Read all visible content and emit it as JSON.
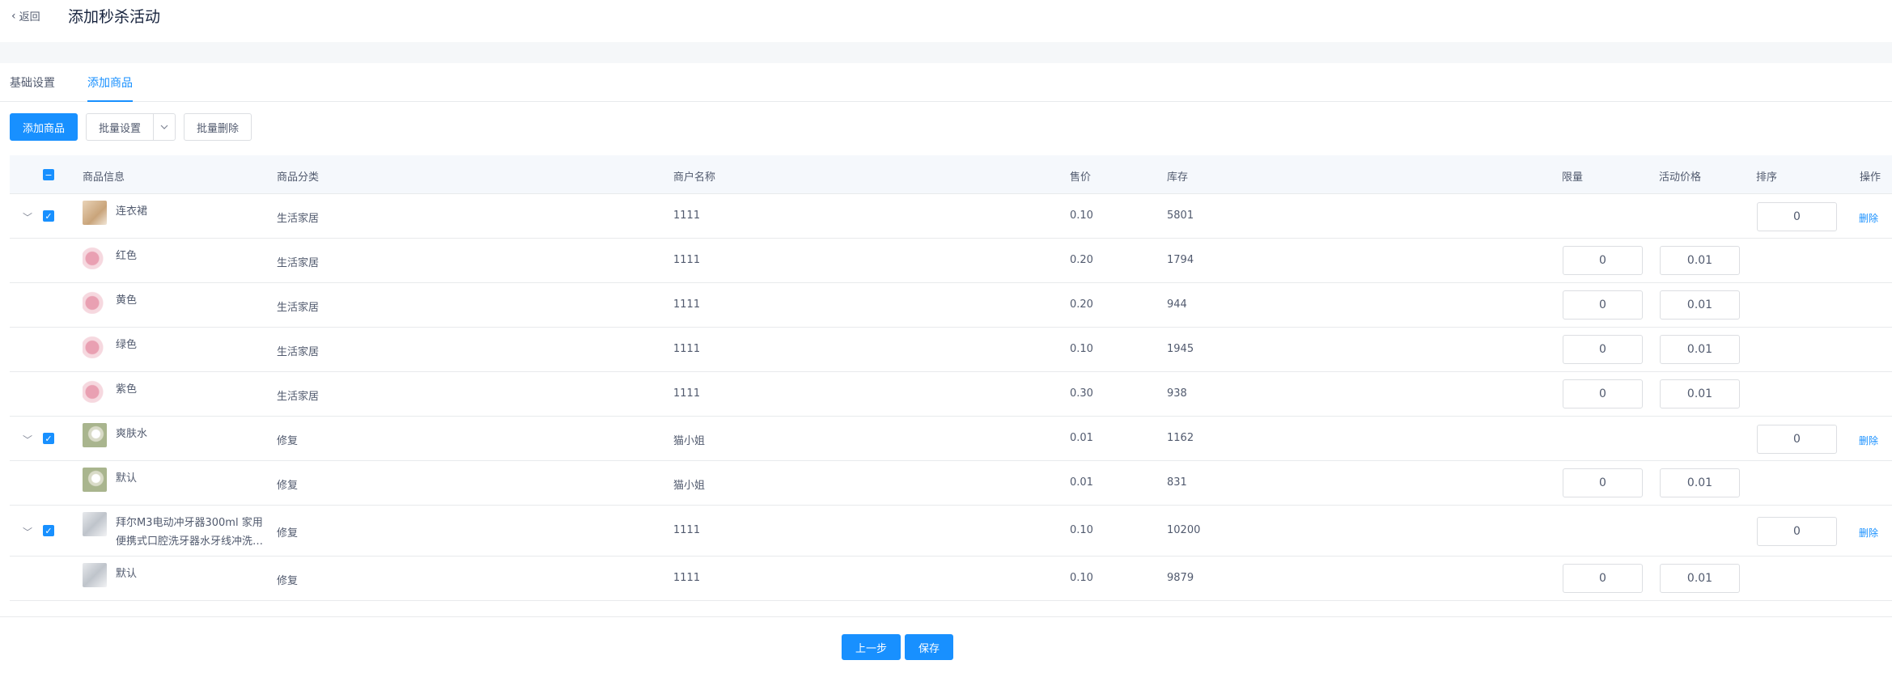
{
  "header": {
    "back_label": "返回",
    "title": "添加秒杀活动"
  },
  "tabs": [
    {
      "label": "基础设置"
    },
    {
      "label": "添加商品"
    }
  ],
  "toolbar": {
    "add_label": "添加商品",
    "batch_set_label": "批量设置",
    "batch_delete_label": "批量删除"
  },
  "table": {
    "columns": [
      "商品信息",
      "商品分类",
      "商户名称",
      "售价",
      "库存",
      "限量",
      "活动价格",
      "排序",
      "操作"
    ],
    "rows": [
      {
        "type": "parent",
        "name": "连衣裙",
        "category": "生活家居",
        "merchant": "1111",
        "price": "0.10",
        "stock": "5801",
        "sort": "0",
        "action": "删除",
        "thumb": "tan"
      },
      {
        "type": "child",
        "name": "红色",
        "category": "生活家居",
        "merchant": "1111",
        "price": "0.20",
        "stock": "1794",
        "limit": "0",
        "activity_price": "0.01",
        "thumb": "pink"
      },
      {
        "type": "child",
        "name": "黄色",
        "category": "生活家居",
        "merchant": "1111",
        "price": "0.20",
        "stock": "944",
        "limit": "0",
        "activity_price": "0.01",
        "thumb": "pink"
      },
      {
        "type": "child",
        "name": "绿色",
        "category": "生活家居",
        "merchant": "1111",
        "price": "0.10",
        "stock": "1945",
        "limit": "0",
        "activity_price": "0.01",
        "thumb": "pink"
      },
      {
        "type": "child",
        "name": "紫色",
        "category": "生活家居",
        "merchant": "1111",
        "price": "0.30",
        "stock": "938",
        "limit": "0",
        "activity_price": "0.01",
        "thumb": "pink"
      },
      {
        "type": "parent",
        "name": "爽肤水",
        "category": "修复",
        "merchant": "猫小姐",
        "price": "0.01",
        "stock": "1162",
        "sort": "0",
        "action": "删除",
        "thumb": "green"
      },
      {
        "type": "child",
        "name": "默认",
        "category": "修复",
        "merchant": "猫小姐",
        "price": "0.01",
        "stock": "831",
        "limit": "0",
        "activity_price": "0.01",
        "thumb": "green"
      },
      {
        "type": "parent",
        "name_line1": "拜尔M3电动冲牙器300ml 家用",
        "name_line2": "便携式口腔洗牙器水牙线冲洗…",
        "category": "修复",
        "merchant": "1111",
        "price": "0.10",
        "stock": "10200",
        "sort": "0",
        "action": "删除",
        "thumb": "gray"
      },
      {
        "type": "child",
        "name": "默认",
        "category": "修复",
        "merchant": "1111",
        "price": "0.10",
        "stock": "9879",
        "limit": "0",
        "activity_price": "0.01",
        "thumb": "gray"
      }
    ]
  },
  "footer": {
    "prev_label": "上一步",
    "save_label": "保存"
  },
  "colors": {
    "primary": "#1890ff",
    "border": "#dcdee2",
    "header_bg": "#f5f8fc"
  }
}
